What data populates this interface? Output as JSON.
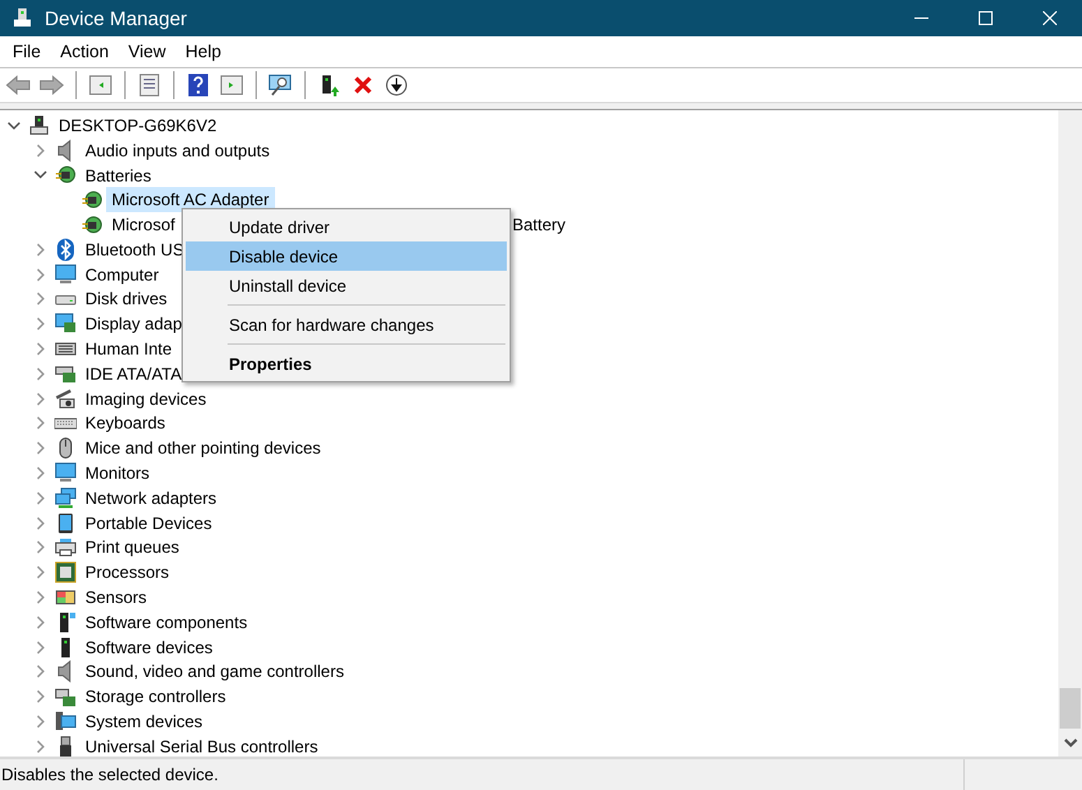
{
  "window": {
    "title": "Device Manager"
  },
  "menu": [
    "File",
    "Action",
    "View",
    "Help"
  ],
  "tree": {
    "label": "DESKTOP-G69K6V2",
    "expanded": true,
    "selected": false,
    "children": [
      {
        "label": "Audio inputs and outputs",
        "expanded": false,
        "selected": false
      },
      {
        "label": "Batteries",
        "expanded": true,
        "selected": false,
        "children": [
          {
            "label": "Microsoft AC Adapter",
            "selected": true
          },
          {
            "label": "Microsof",
            "tail": "Battery",
            "selected": false
          }
        ]
      },
      {
        "label": "Bluetooth US",
        "expanded": false,
        "selected": false
      },
      {
        "label": "Computer",
        "expanded": false,
        "selected": false
      },
      {
        "label": "Disk drives",
        "expanded": false,
        "selected": false
      },
      {
        "label": "Display adap",
        "expanded": false,
        "selected": false
      },
      {
        "label": "Human Inte",
        "expanded": false,
        "selected": false
      },
      {
        "label": "IDE ATA/ATA",
        "expanded": false,
        "selected": false
      },
      {
        "label": "Imaging devices",
        "expanded": false,
        "selected": false
      },
      {
        "label": "Keyboards",
        "expanded": false,
        "selected": false
      },
      {
        "label": "Mice and other pointing devices",
        "expanded": false,
        "selected": false
      },
      {
        "label": "Monitors",
        "expanded": false,
        "selected": false
      },
      {
        "label": "Network adapters",
        "expanded": false,
        "selected": false
      },
      {
        "label": "Portable Devices",
        "expanded": false,
        "selected": false
      },
      {
        "label": "Print queues",
        "expanded": false,
        "selected": false
      },
      {
        "label": "Processors",
        "expanded": false,
        "selected": false
      },
      {
        "label": "Sensors",
        "expanded": false,
        "selected": false
      },
      {
        "label": "Software components",
        "expanded": false,
        "selected": false
      },
      {
        "label": "Software devices",
        "expanded": false,
        "selected": false
      },
      {
        "label": "Sound, video and game controllers",
        "expanded": false,
        "selected": false
      },
      {
        "label": "Storage controllers",
        "expanded": false,
        "selected": false
      },
      {
        "label": "System devices",
        "expanded": false,
        "selected": false
      },
      {
        "label": "Universal Serial Bus controllers",
        "expanded": false,
        "selected": false
      }
    ]
  },
  "context_menu": [
    {
      "kind": "item",
      "label": "Update driver",
      "selected": false,
      "default": false
    },
    {
      "kind": "item",
      "label": "Disable device",
      "selected": true,
      "default": false
    },
    {
      "kind": "item",
      "label": "Uninstall device",
      "selected": false,
      "default": false
    },
    {
      "kind": "separator"
    },
    {
      "kind": "item",
      "label": "Scan for hardware changes",
      "selected": false,
      "default": false
    },
    {
      "kind": "separator"
    },
    {
      "kind": "item",
      "label": "Properties",
      "selected": false,
      "default": true
    }
  ],
  "status_bar": "Disables the selected device."
}
